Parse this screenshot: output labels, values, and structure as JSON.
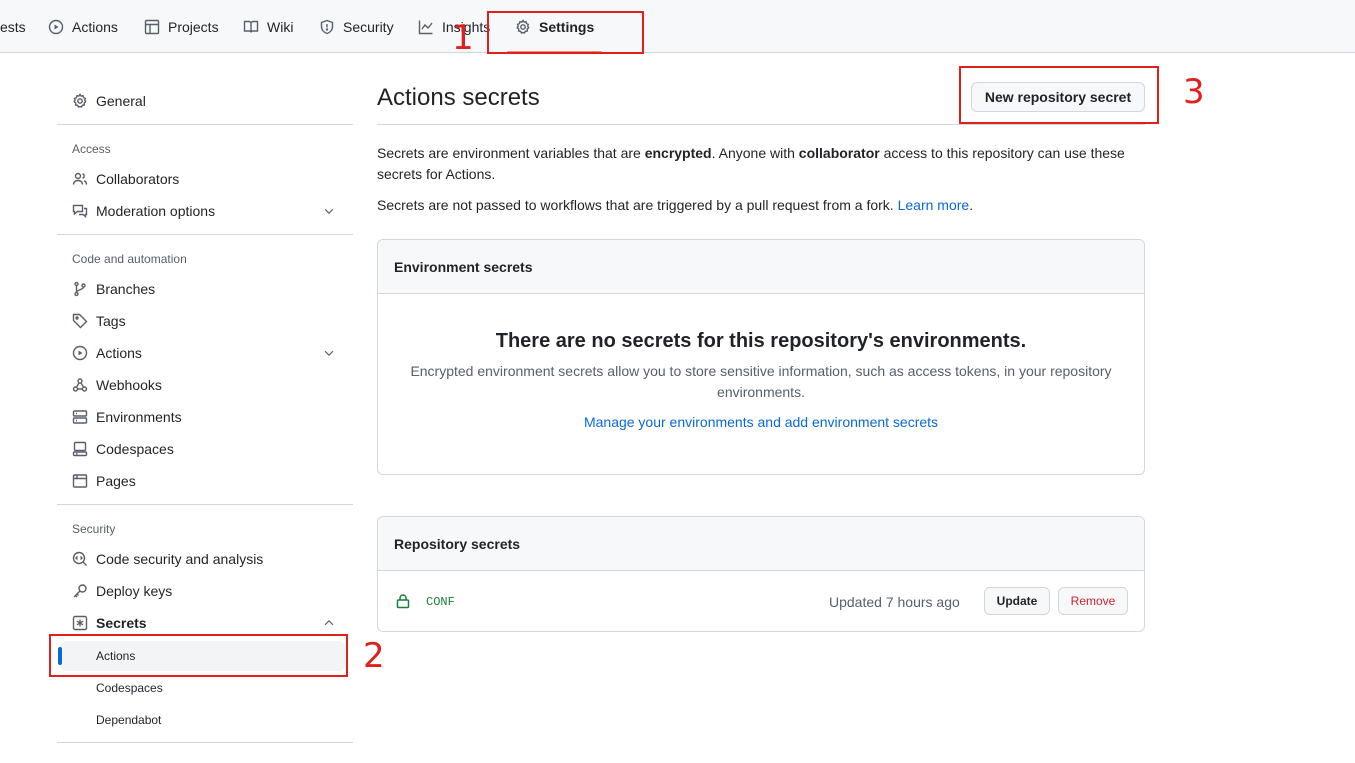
{
  "topnav": {
    "tabs": [
      {
        "label": "ests",
        "icon": "pull-request-icon"
      },
      {
        "label": "Actions",
        "icon": "play-icon"
      },
      {
        "label": "Projects",
        "icon": "table-icon"
      },
      {
        "label": "Wiki",
        "icon": "book-icon"
      },
      {
        "label": "Security",
        "icon": "shield-icon"
      },
      {
        "label": "Insights",
        "icon": "graph-icon"
      },
      {
        "label": "Settings",
        "icon": "gear-icon",
        "selected": true
      }
    ]
  },
  "sidebar": {
    "general": "General",
    "access_header": "Access",
    "collaborators": "Collaborators",
    "moderation": "Moderation options",
    "code_header": "Code and automation",
    "branches": "Branches",
    "tags": "Tags",
    "actions": "Actions",
    "webhooks": "Webhooks",
    "environments": "Environments",
    "codespaces": "Codespaces",
    "pages": "Pages",
    "security_header": "Security",
    "code_security": "Code security and analysis",
    "deploy_keys": "Deploy keys",
    "secrets": "Secrets",
    "secrets_sub": [
      "Actions",
      "Codespaces",
      "Dependabot"
    ]
  },
  "main": {
    "title": "Actions secrets",
    "new_secret_button": "New repository secret",
    "intro_1": "Secrets are environment variables that are",
    "intro_bold_1": "encrypted",
    "intro_2": ". Anyone with",
    "intro_bold_2": "collaborator",
    "intro_3": "access to this repository can use these secrets for Actions.",
    "intro_line2": "Secrets are not passed to workflows that are triggered by a pull request from a fork.",
    "learn_more": "Learn more",
    "env_box": {
      "header": "Environment secrets",
      "empty_title": "There are no secrets for this repository's environments.",
      "empty_desc": "Encrypted environment secrets allow you to store sensitive information, such as access tokens, in your repository environments.",
      "manage_link": "Manage your environments and add environment secrets"
    },
    "repo_box": {
      "header": "Repository secrets",
      "secrets": [
        {
          "name": "CONF",
          "updated": "Updated 7 hours ago",
          "update_label": "Update",
          "remove_label": "Remove"
        }
      ]
    }
  },
  "annotations": [
    "1",
    "2",
    "3"
  ],
  "colors": {
    "accent": "#0969da",
    "annotation": "#e0201d",
    "danger": "#cf222e",
    "success": "#1a7f37"
  }
}
